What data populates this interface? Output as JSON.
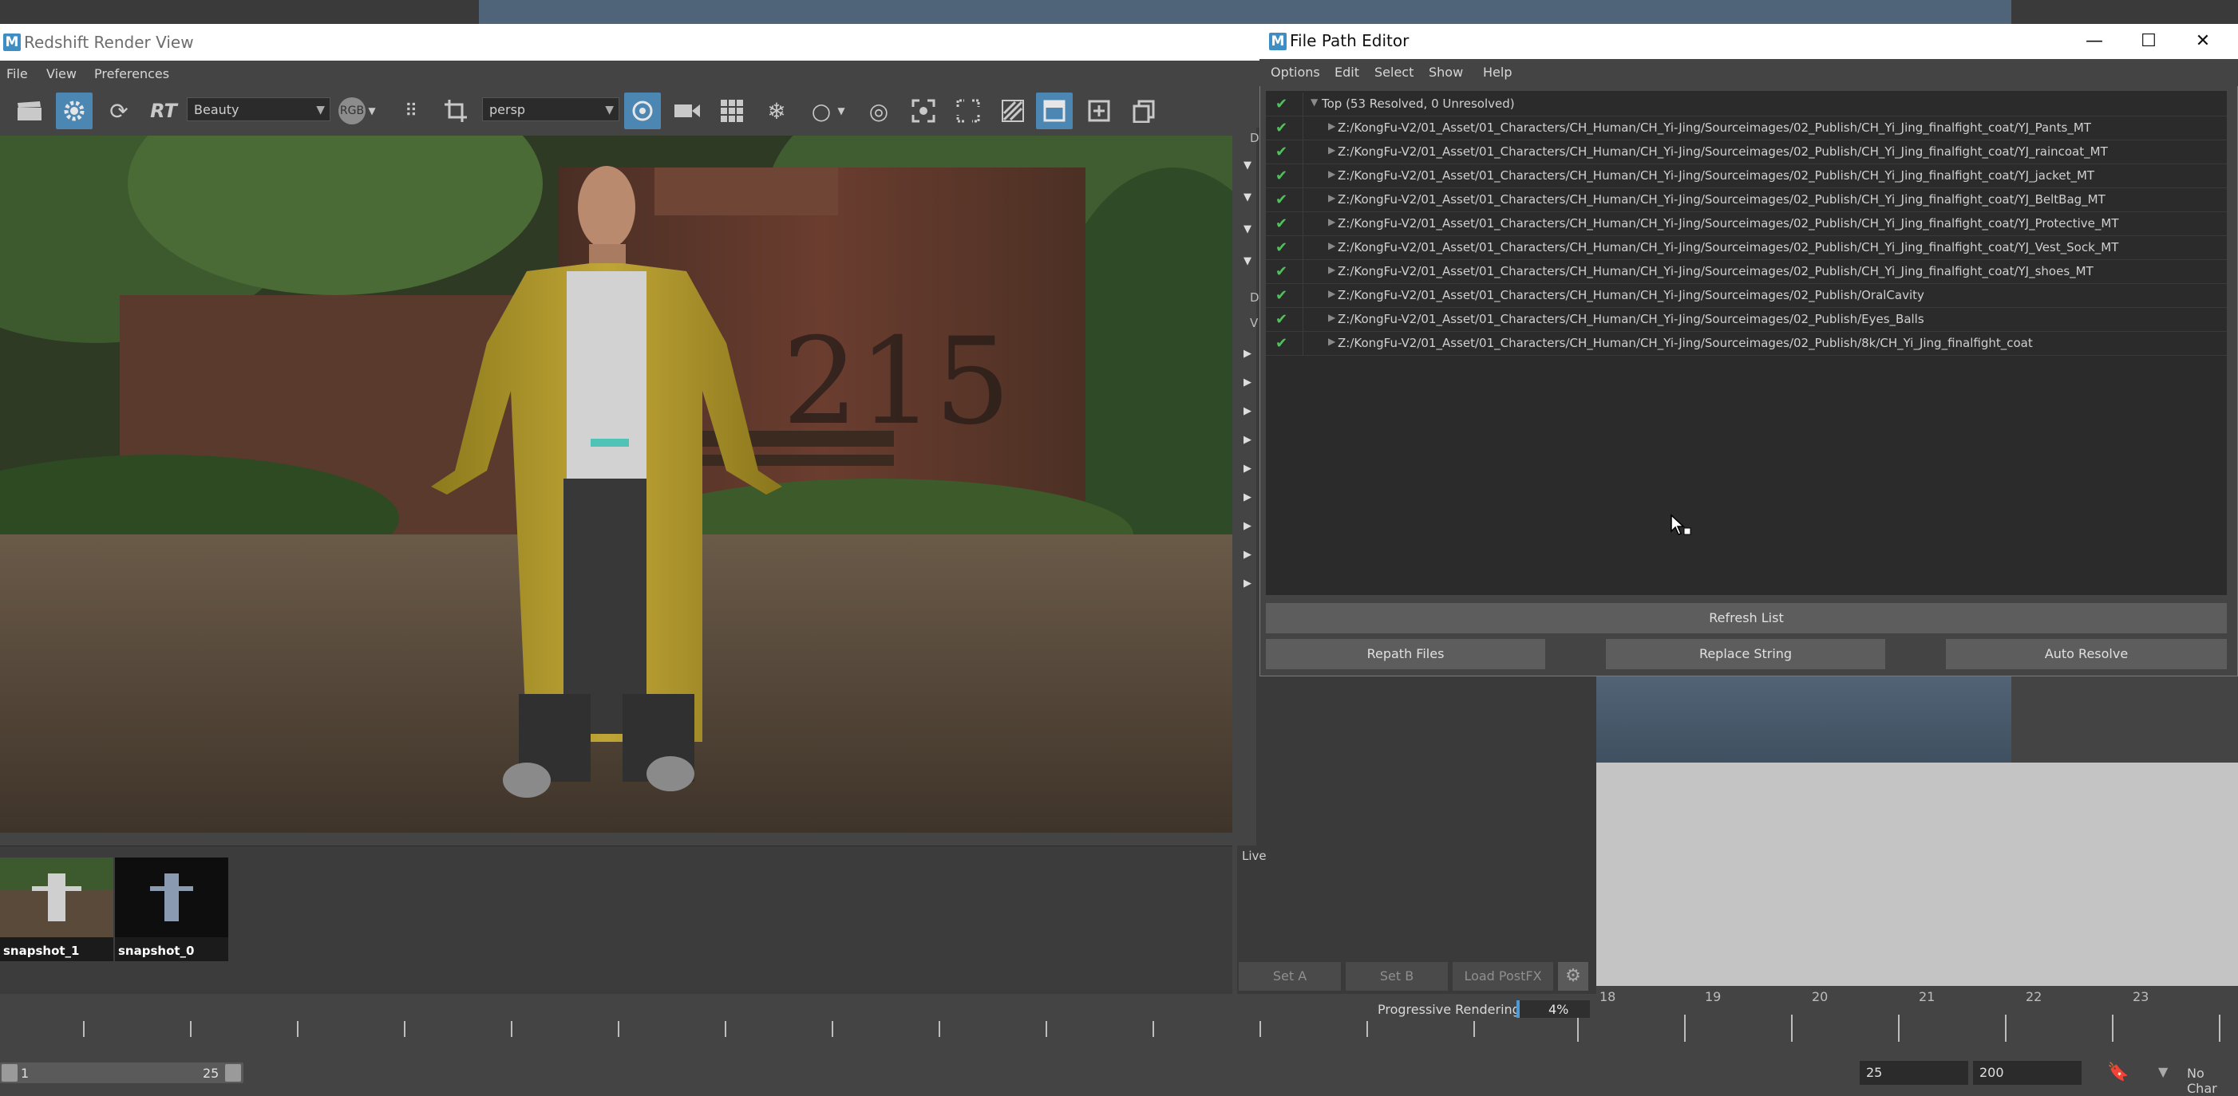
{
  "redshift": {
    "title": "Redshift Render View",
    "menu": [
      "File",
      "View",
      "Preferences"
    ],
    "aov_select": "Beauty",
    "rgb_label": "RGB",
    "rt_label": "RT",
    "camera_select": "persp",
    "side_letters": [
      "D",
      "D",
      "V"
    ]
  },
  "snapshots": [
    {
      "label": "snapshot_1"
    },
    {
      "label": "snapshot_0"
    }
  ],
  "live_panel": {
    "label": "Live",
    "set_a": "Set A",
    "set_b": "Set B",
    "load_postfx": "Load PostFX"
  },
  "progress": {
    "label": "Progressive Rendering...",
    "percent_text": "4%",
    "value": 0.04
  },
  "timeline": {
    "ticks": [
      "18",
      "19",
      "20",
      "21",
      "22",
      "23"
    ],
    "range_start": "1",
    "range_end": "25",
    "current_end": "25",
    "anim_end": "200",
    "char_set": "No Char"
  },
  "file_path_editor": {
    "title": "File Path Editor",
    "menu": [
      "Options",
      "Edit",
      "Select",
      "Show",
      "Help"
    ],
    "top_label": "Top (53 Resolved, 0 Unresolved)",
    "rows": [
      "Z:/KongFu-V2/01_Asset/01_Characters/CH_Human/CH_Yi-Jing/Sourceimages/02_Publish/CH_Yi_Jing_finalfight_coat/YJ_Pants_MT",
      "Z:/KongFu-V2/01_Asset/01_Characters/CH_Human/CH_Yi-Jing/Sourceimages/02_Publish/CH_Yi_Jing_finalfight_coat/YJ_raincoat_MT",
      "Z:/KongFu-V2/01_Asset/01_Characters/CH_Human/CH_Yi-Jing/Sourceimages/02_Publish/CH_Yi_Jing_finalfight_coat/YJ_jacket_MT",
      "Z:/KongFu-V2/01_Asset/01_Characters/CH_Human/CH_Yi-Jing/Sourceimages/02_Publish/CH_Yi_Jing_finalfight_coat/YJ_BeltBag_MT",
      "Z:/KongFu-V2/01_Asset/01_Characters/CH_Human/CH_Yi-Jing/Sourceimages/02_Publish/CH_Yi_Jing_finalfight_coat/YJ_Protective_MT",
      "Z:/KongFu-V2/01_Asset/01_Characters/CH_Human/CH_Yi-Jing/Sourceimages/02_Publish/CH_Yi_Jing_finalfight_coat/YJ_Vest_Sock_MT",
      "Z:/KongFu-V2/01_Asset/01_Characters/CH_Human/CH_Yi-Jing/Sourceimages/02_Publish/CH_Yi_Jing_finalfight_coat/YJ_shoes_MT",
      "Z:/KongFu-V2/01_Asset/01_Characters/CH_Human/CH_Yi-Jing/Sourceimages/02_Publish/OralCavity",
      "Z:/KongFu-V2/01_Asset/01_Characters/CH_Human/CH_Yi-Jing/Sourceimages/02_Publish/Eyes_Balls",
      "Z:/KongFu-V2/01_Asset/01_Characters/CH_Human/CH_Yi-Jing/Sourceimages/02_Publish/8k/CH_Yi_Jing_finalfight_coat"
    ],
    "refresh_label": "Refresh List",
    "repath_label": "Repath Files",
    "replace_label": "Replace String",
    "auto_label": "Auto Resolve"
  },
  "colors": {
    "accent": "#4c86b3",
    "resolved": "#4fc35a",
    "progress": "#4f9ad4"
  }
}
